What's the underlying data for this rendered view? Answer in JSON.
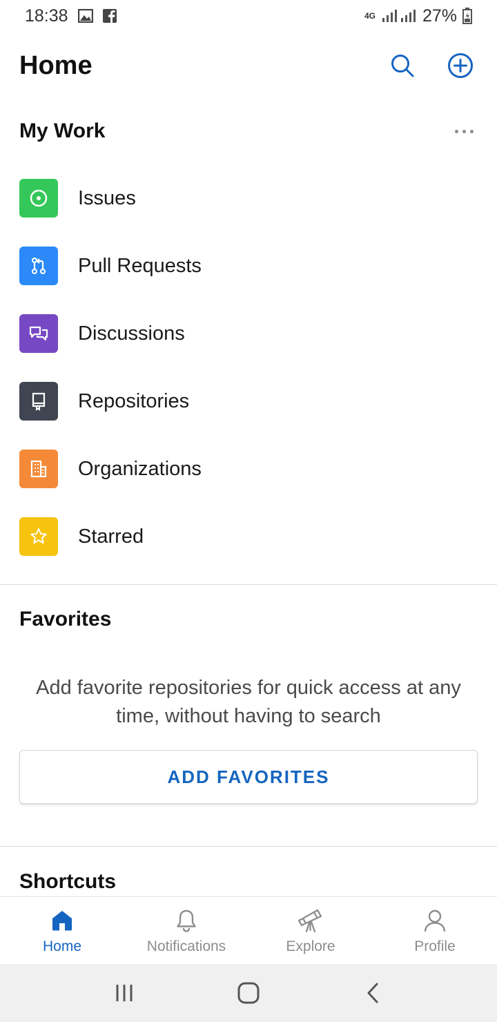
{
  "status_bar": {
    "time": "18:38",
    "network": "4G",
    "battery": "27%",
    "icons": [
      "gallery-icon",
      "facebook-icon",
      "signal-icon",
      "battery-icon"
    ]
  },
  "header": {
    "title": "Home",
    "actions": [
      "search-icon",
      "add-circle-icon"
    ]
  },
  "my_work": {
    "title": "My Work",
    "items": [
      {
        "label": "Issues",
        "icon": "issue-icon",
        "color": "#34c759"
      },
      {
        "label": "Pull Requests",
        "icon": "pull-request-icon",
        "color": "#2b8af7"
      },
      {
        "label": "Discussions",
        "icon": "discussion-icon",
        "color": "#7748c4"
      },
      {
        "label": "Repositories",
        "icon": "repository-icon",
        "color": "#404552"
      },
      {
        "label": "Organizations",
        "icon": "organization-icon",
        "color": "#f48a38"
      },
      {
        "label": "Starred",
        "icon": "star-icon",
        "color": "#f6c30f"
      }
    ]
  },
  "favorites": {
    "title": "Favorites",
    "empty_text": "Add favorite repositories for quick access at any time, without having to search",
    "button_label": "ADD FAVORITES"
  },
  "shortcuts": {
    "title": "Shortcuts"
  },
  "bottom_nav": {
    "items": [
      {
        "label": "Home",
        "icon": "home-icon",
        "active": true
      },
      {
        "label": "Notifications",
        "icon": "bell-icon",
        "active": false
      },
      {
        "label": "Explore",
        "icon": "telescope-icon",
        "active": false
      },
      {
        "label": "Profile",
        "icon": "person-icon",
        "active": false
      }
    ]
  },
  "colors": {
    "accent": "#1565c0",
    "inactive": "#8d8d8d"
  }
}
